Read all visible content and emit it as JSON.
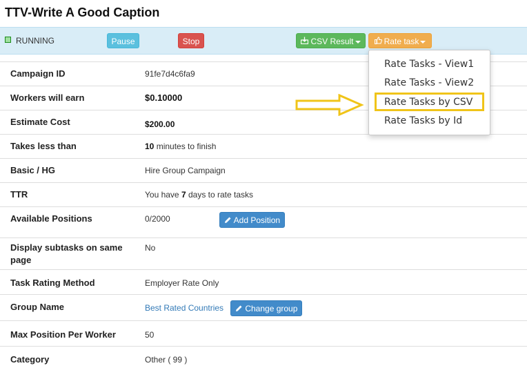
{
  "title": "TTV-Write A Good Caption",
  "status": {
    "text": "RUNNING",
    "color": "#9fe09f"
  },
  "toolbar": {
    "pause_label": "Pause",
    "stop_label": "Stop",
    "csv_label": "CSV Result",
    "rate_label": "Rate task"
  },
  "rate_menu": {
    "items": [
      "Rate Tasks - View1",
      "Rate Tasks - View2",
      "Rate Tasks by CSV",
      "Rate Tasks by Id"
    ],
    "highlighted": "Rate Tasks by CSV",
    "highlight_color": "#f0c419"
  },
  "details": {
    "campaign_id": {
      "label": "Campaign ID",
      "value": "91fe7d4c6fa9"
    },
    "workers_earn": {
      "label": "Workers will earn",
      "value": "$0.10000"
    },
    "estimate_cost": {
      "label": "Estimate Cost",
      "value": "$200.00"
    },
    "takes_less": {
      "label": "Takes less than",
      "value": "10",
      "suffix": "minutes to finish"
    },
    "basic_hg": {
      "label": "Basic / HG",
      "value": "Hire Group Campaign"
    },
    "ttr": {
      "label": "TTR",
      "prefix": "You have",
      "value": "7",
      "suffix": "days to rate tasks"
    },
    "available_positions": {
      "label": "Available Positions",
      "value": "0/2000",
      "button": "Add Position"
    },
    "display_subtasks": {
      "label": "Display subtasks on same page",
      "value": "No"
    },
    "task_rating": {
      "label": "Task Rating Method",
      "value": "Employer Rate Only"
    },
    "group_name": {
      "label": "Group Name",
      "value": "Best Rated Countries",
      "button": "Change group"
    },
    "max_position": {
      "label": "Max Position Per Worker",
      "value": "50"
    },
    "category": {
      "label": "Category",
      "value": "Other ( 99 )"
    }
  }
}
